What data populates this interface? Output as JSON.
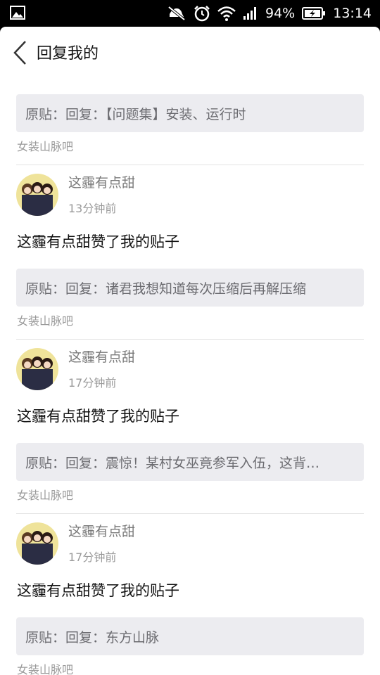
{
  "status_bar": {
    "battery": "94%",
    "time": "13:14",
    "icons": [
      "gallery-icon",
      "mute-icon",
      "alarm-icon",
      "wifi-icon",
      "signal-icon",
      "battery-charging-icon"
    ]
  },
  "header": {
    "title": "回复我的",
    "back_icon": "chevron-left-icon"
  },
  "first_item": {
    "quote": "原贴：回复：【问题集】安装、运行时",
    "forum": "女装山脉吧"
  },
  "items": [
    {
      "user": "这霾有点甜",
      "time": "13分钟前",
      "action": "这霾有点甜赞了我的贴子",
      "quote": "原贴：回复：诸君我想知道每次压缩后再解压缩",
      "forum": "女装山脉吧"
    },
    {
      "user": "这霾有点甜",
      "time": "17分钟前",
      "action": "这霾有点甜赞了我的贴子",
      "quote": "原贴：回复：震惊！某村女巫竟参军入伍，这背…",
      "forum": "女装山脉吧"
    },
    {
      "user": "这霾有点甜",
      "time": "17分钟前",
      "action": "这霾有点甜赞了我的贴子",
      "quote": "原贴：回复：东方山脉",
      "forum": "女装山脉吧"
    }
  ]
}
